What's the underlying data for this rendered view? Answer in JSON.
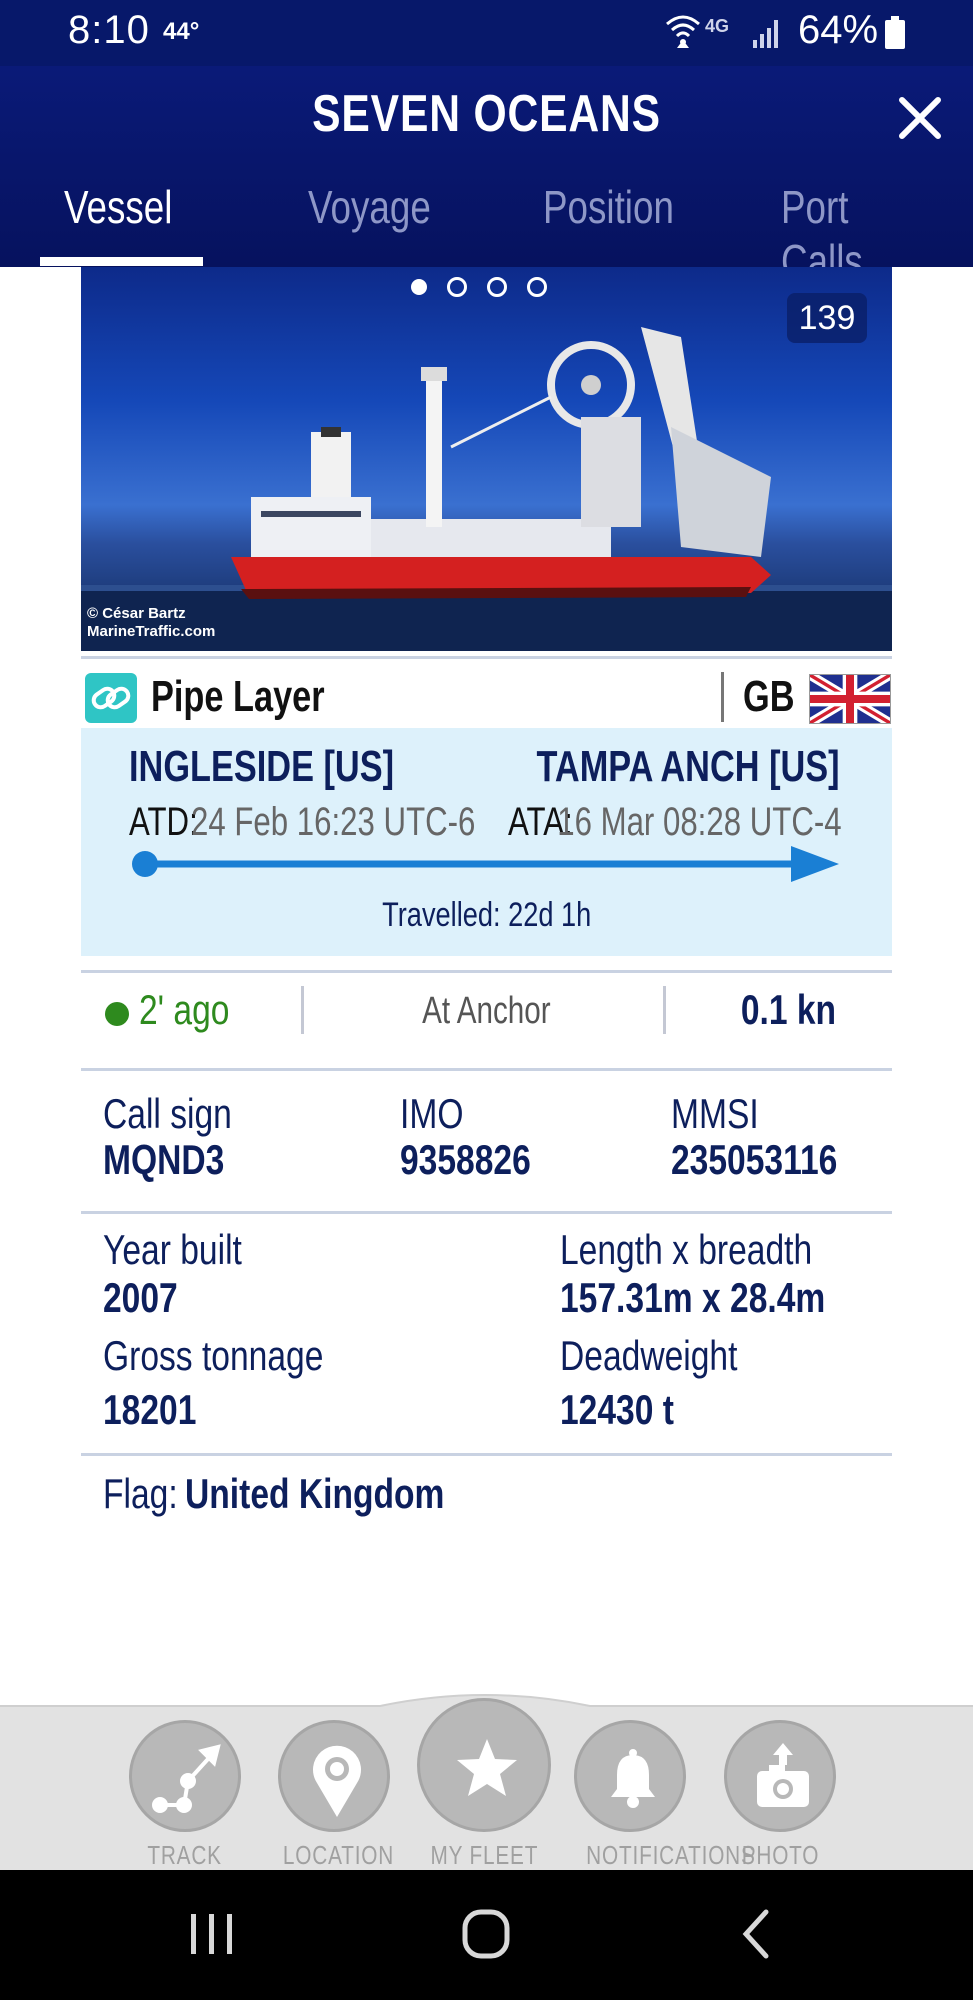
{
  "status_bar": {
    "time": "8:10",
    "temperature": "44°",
    "network": "4G",
    "battery": "64%"
  },
  "header": {
    "title": "SEVEN OCEANS",
    "tabs": [
      {
        "label": "Vessel",
        "active": true
      },
      {
        "label": "Voyage",
        "active": false
      },
      {
        "label": "Position",
        "active": false
      },
      {
        "label": "Port Calls",
        "active": false
      }
    ]
  },
  "photo": {
    "count": "139",
    "credit_line1": "© César Bartz",
    "credit_line2": "MarineTraffic.com",
    "current_index": 1,
    "total": 4
  },
  "vessel": {
    "type": "Pipe Layer",
    "flag_code": "GB"
  },
  "voyage": {
    "from_port": "INGLESIDE [US]",
    "to_port": "TAMPA ANCH [US]",
    "atd_label": "ATD:",
    "atd_value": "24 Feb 16:23 UTC-6",
    "ata_label": "ATA:",
    "ata_value": "16 Mar 08:28 UTC-4",
    "travelled": "Travelled: 22d 1h",
    "progress": 1.0
  },
  "status": {
    "last_seen": "2' ago",
    "nav_status": "At Anchor",
    "speed": "0.1 kn"
  },
  "details": {
    "call_sign_label": "Call sign",
    "call_sign": "MQND3",
    "imo_label": "IMO",
    "imo": "9358826",
    "mmsi_label": "MMSI",
    "mmsi": "235053116",
    "year_built_label": "Year built",
    "year_built": "2007",
    "length_breadth_label": "Length x breadth",
    "length_breadth": "157.31m x 28.4m",
    "gross_tonnage_label": "Gross tonnage",
    "gross_tonnage": "18201",
    "deadweight_label": "Deadweight",
    "deadweight": "12430 t",
    "flag_label": "Flag:",
    "flag": "United Kingdom"
  },
  "toolbar": {
    "items": [
      {
        "label": "TRACK",
        "icon": "track-icon"
      },
      {
        "label": "LOCATION",
        "icon": "location-pin-icon"
      },
      {
        "label": "MY FLEET",
        "icon": "star-icon"
      },
      {
        "label": "NOTIFICATIONS",
        "icon": "bell-icon"
      },
      {
        "label": "PHOTO",
        "icon": "camera-upload-icon"
      }
    ]
  },
  "colors": {
    "header_bg": "#07186a",
    "accent_blue": "#1a7fd4",
    "voyage_bg": "#ddf1fb",
    "online_green": "#2e8a1e",
    "text_navy": "#0d1f5c"
  }
}
